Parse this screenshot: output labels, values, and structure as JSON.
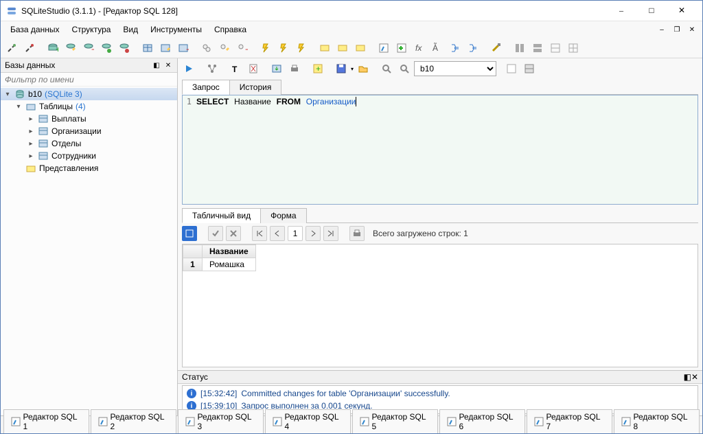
{
  "title": "SQLiteStudio (3.1.1) - [Редактор SQL 128]",
  "menubar": [
    "База данных",
    "Структура",
    "Вид",
    "Инструменты",
    "Справка"
  ],
  "sidebar": {
    "title": "Базы данных",
    "filter_placeholder": "Фильтр по имени",
    "db": {
      "name": "b10",
      "type": "(SQLite 3)"
    },
    "tables_label": "Таблицы",
    "tables_count": "(4)",
    "tables": [
      "Выплаты",
      "Организации",
      "Отделы",
      "Сотрудники"
    ],
    "views_label": "Представления"
  },
  "editor": {
    "db_selected": "b10",
    "tabs": {
      "query": "Запрос",
      "history": "История"
    },
    "sql": {
      "kw1": "SELECT",
      "col": "Название",
      "kw2": "FROM",
      "tbl": "Организации"
    },
    "result_tabs": {
      "grid": "Табличный вид",
      "form": "Форма"
    },
    "page_num": "1",
    "rows_loaded": "Всего загружено строк: 1",
    "header": "Название",
    "row1_num": "1",
    "row1_val": "Ромашка"
  },
  "status": {
    "title": "Статус",
    "log1_time": "[15:32:42]",
    "log1_msg": "Committed changes for table 'Организации' successfully.",
    "log2_time": "[15:39:10]",
    "log2_msg": "Запрос выполнен за 0.001 секунд."
  },
  "bottom_tabs": [
    "Редактор SQL 1",
    "Редактор SQL 2",
    "Редактор SQL 3",
    "Редактор SQL 4",
    "Редактор SQL 5",
    "Редактор SQL 6",
    "Редактор SQL 7",
    "Редактор SQL 8"
  ]
}
